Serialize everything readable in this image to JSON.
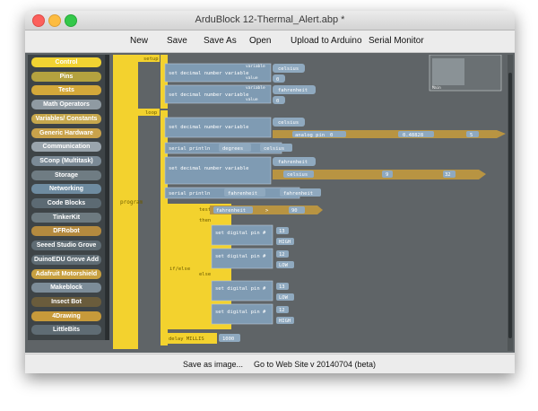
{
  "window": {
    "title": "ArduBlock 12-Thermal_Alert.abp *"
  },
  "menu": {
    "new": "New",
    "save": "Save",
    "save_as": "Save As",
    "open": "Open",
    "upload": "Upload to Arduino",
    "serial_monitor": "Serial Monitor"
  },
  "sidebar": {
    "items": [
      {
        "label": "Control",
        "color": "#f1d332"
      },
      {
        "label": "Pins",
        "color": "#b4a23f"
      },
      {
        "label": "Tests",
        "color": "#d3a83a"
      },
      {
        "label": "Math Operators",
        "color": "#8f9aa2"
      },
      {
        "label": "Variables/ Constants",
        "color": "#c6a74d"
      },
      {
        "label": "Generic Hardware",
        "color": "#c9a24b"
      },
      {
        "label": "Communication",
        "color": "#9aa5ad"
      },
      {
        "label": "SConp (Multitask)",
        "color": "#7b8a96"
      },
      {
        "label": "Storage",
        "color": "#6f7c83"
      },
      {
        "label": "Networking",
        "color": "#6e8ba0"
      },
      {
        "label": "Code Blocks",
        "color": "#5c6a73"
      },
      {
        "label": "TinkerKit",
        "color": "#6d7a80"
      },
      {
        "label": "DFRobot",
        "color": "#b48a3f"
      },
      {
        "label": "Seeed Studio Grove",
        "color": "#5f6c74"
      },
      {
        "label": "DuinoEDU Grove Add",
        "color": "#5f6c74"
      },
      {
        "label": "Adafruit Motorshield",
        "color": "#c8a040"
      },
      {
        "label": "Makeblock",
        "color": "#7c8c98"
      },
      {
        "label": "Insect Bot",
        "color": "#6a5c3c"
      },
      {
        "label": "4Drawing",
        "color": "#c79a3a"
      },
      {
        "label": "LittleBits",
        "color": "#5f6c74"
      }
    ]
  },
  "blocks": {
    "program": "program",
    "setup": "setup",
    "loop": "loop",
    "set_decimal": "set decimal number variable",
    "variable": "variable",
    "value": "value",
    "celsius": "celsius",
    "fahrenheit": "fahrenheit",
    "zero": "0",
    "analog_pin": "analog pin #",
    "pin_a0": "0",
    "factor": "0.48828",
    "nine": "9",
    "five": "5",
    "thirty_two": "32",
    "serial_println": "serial println",
    "deg_c": "degrees",
    "deg_f": "fahrenheit",
    "glue": "glue",
    "ifelse": "if/else",
    "test": "test",
    "then": "then",
    "else": "else",
    "set_digital_pin": "set digital pin #",
    "pin13": "13",
    "pin12": "12",
    "high": "HIGH",
    "low": "LOW",
    "gt": ">",
    "threshold": "90",
    "delay": "delay MILLIS",
    "delay_val": "1000",
    "minimap_label": "Main"
  },
  "status": {
    "save_image": "Save as image...",
    "website": "Go to Web Site",
    "version": "v 20140704 (beta)"
  }
}
